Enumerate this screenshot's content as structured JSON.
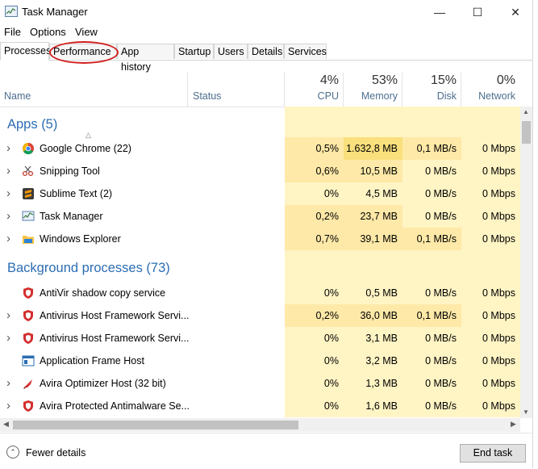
{
  "window": {
    "title": "Task Manager",
    "controls": {
      "minimize": "—",
      "maximize": "☐",
      "close": "✕"
    }
  },
  "menu": [
    "File",
    "Options",
    "View"
  ],
  "tabs": [
    "Processes",
    "Performance",
    "App history",
    "Startup",
    "Users",
    "Details",
    "Services"
  ],
  "active_tab": "Processes",
  "highlighted_tab": "Performance",
  "header": {
    "name": "Name",
    "status": "Status",
    "cpu": {
      "pct": "4%",
      "label": "CPU"
    },
    "memory": {
      "pct": "53%",
      "label": "Memory"
    },
    "disk": {
      "pct": "15%",
      "label": "Disk"
    },
    "network": {
      "pct": "0%",
      "label": "Network"
    }
  },
  "groups": {
    "apps": {
      "title": "Apps (5)",
      "rows": [
        {
          "name": "Google Chrome (22)",
          "icon": "chrome-icon",
          "cpu": "0,5%",
          "memory": "1.632,8 MB",
          "disk": "0,1 MB/s",
          "network": "0 Mbps"
        },
        {
          "name": "Snipping Tool",
          "icon": "scissors-icon",
          "cpu": "0,6%",
          "memory": "10,5 MB",
          "disk": "0 MB/s",
          "network": "0 Mbps"
        },
        {
          "name": "Sublime Text (2)",
          "icon": "sublime-icon",
          "cpu": "0%",
          "memory": "4,5 MB",
          "disk": "0 MB/s",
          "network": "0 Mbps"
        },
        {
          "name": "Task Manager",
          "icon": "task-manager-icon",
          "cpu": "0,2%",
          "memory": "23,7 MB",
          "disk": "0 MB/s",
          "network": "0 Mbps"
        },
        {
          "name": "Windows Explorer",
          "icon": "folder-icon",
          "cpu": "0,7%",
          "memory": "39,1 MB",
          "disk": "0,1 MB/s",
          "network": "0 Mbps"
        }
      ]
    },
    "background": {
      "title": "Background processes (73)",
      "rows": [
        {
          "name": "AntiVir shadow copy service",
          "icon": "shield-icon",
          "cpu": "0%",
          "memory": "0,5 MB",
          "disk": "0 MB/s",
          "network": "0 Mbps"
        },
        {
          "name": "Antivirus Host Framework Servi...",
          "icon": "shield-icon",
          "cpu": "0,2%",
          "memory": "36,0 MB",
          "disk": "0,1 MB/s",
          "network": "0 Mbps"
        },
        {
          "name": "Antivirus Host Framework Servi...",
          "icon": "shield-icon",
          "cpu": "0%",
          "memory": "3,1 MB",
          "disk": "0 MB/s",
          "network": "0 Mbps"
        },
        {
          "name": "Application Frame Host",
          "icon": "app-frame-icon",
          "cpu": "0%",
          "memory": "3,2 MB",
          "disk": "0 MB/s",
          "network": "0 Mbps"
        },
        {
          "name": "Avira Optimizer Host (32 bit)",
          "icon": "rocket-icon",
          "cpu": "0%",
          "memory": "1,3 MB",
          "disk": "0 MB/s",
          "network": "0 Mbps"
        },
        {
          "name": "Avira Protected Antimalware Se...",
          "icon": "shield-icon",
          "cpu": "0%",
          "memory": "1,6 MB",
          "disk": "0 MB/s",
          "network": "0 Mbps"
        }
      ]
    }
  },
  "footer": {
    "fewer_details": "Fewer details",
    "end_task": "End task"
  },
  "colors": {
    "cell_light": "#fff4c4",
    "cell_mid": "#ffe9a8",
    "cell_strong": "#f9e07d",
    "group_title": "#2c6db4",
    "highlight_circle": "#d21f1f"
  }
}
